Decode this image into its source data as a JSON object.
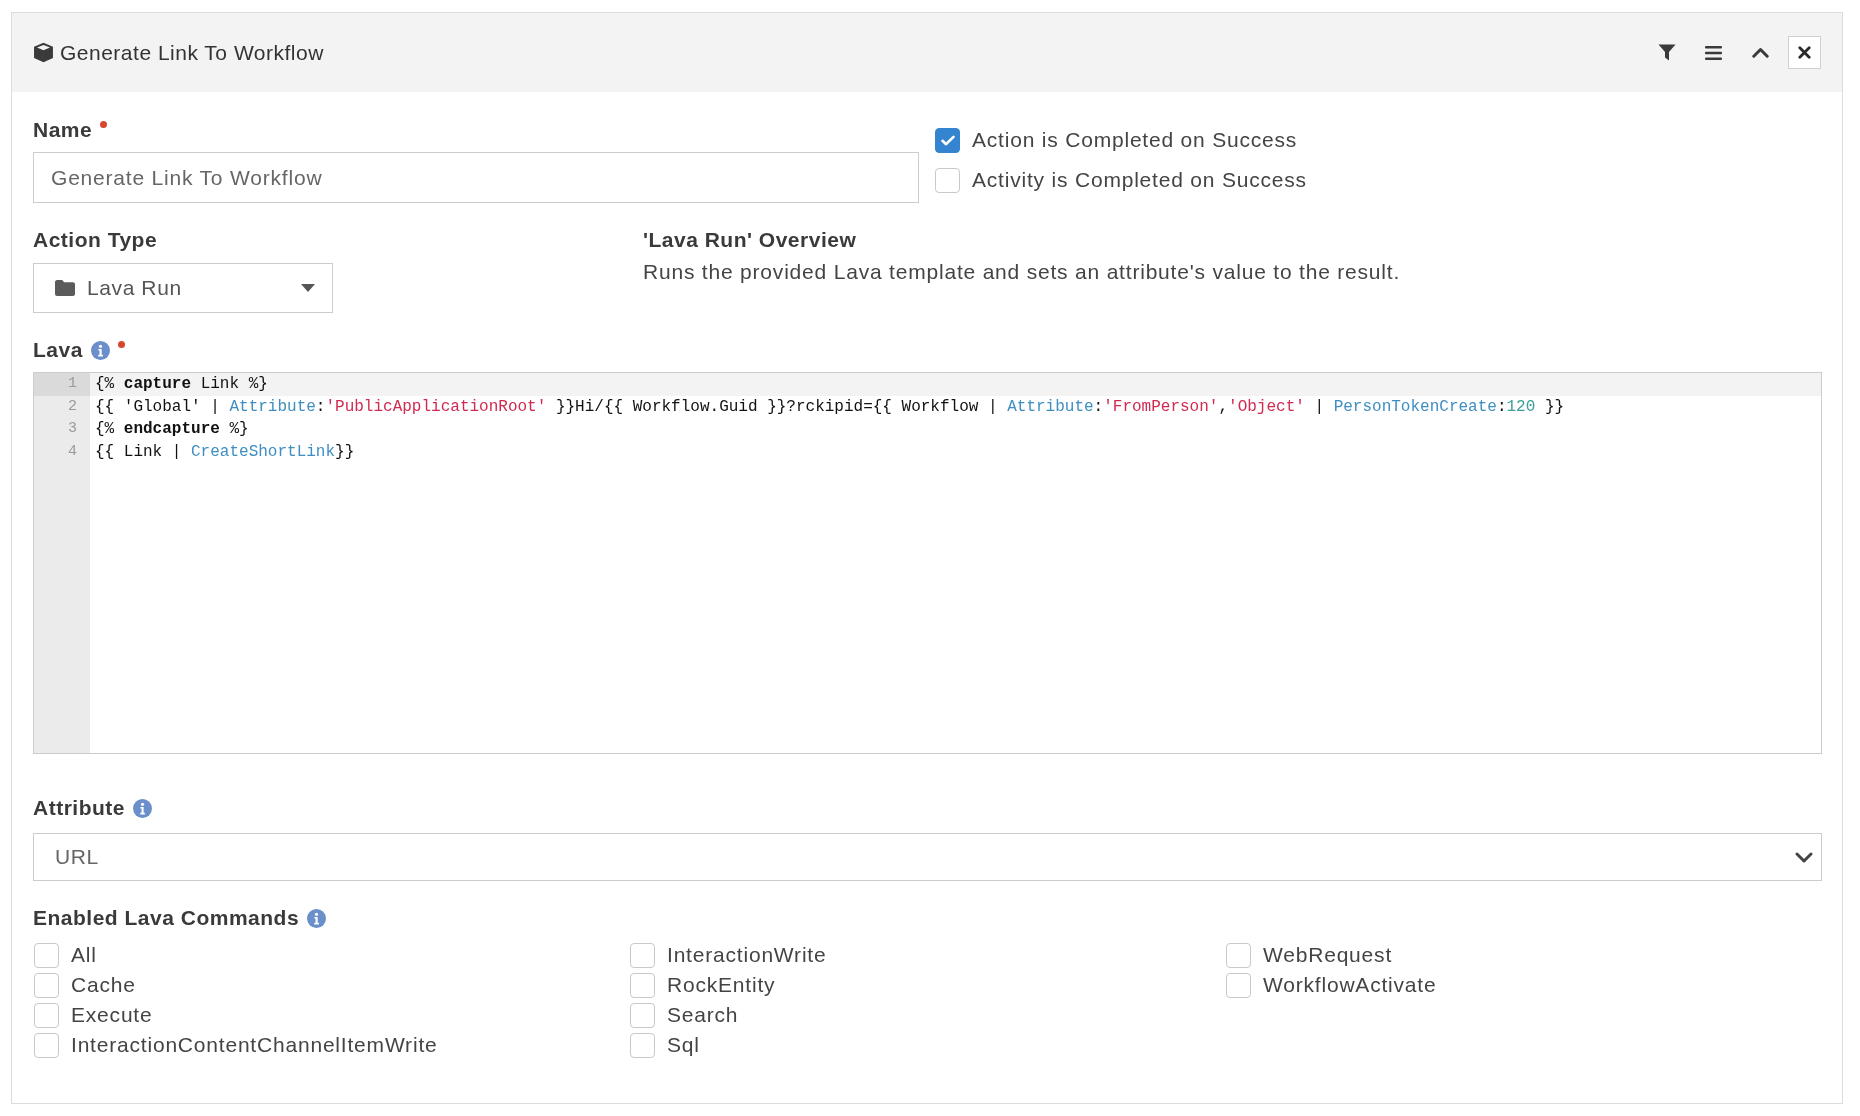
{
  "panel": {
    "title": "Generate Link To Workflow"
  },
  "name": {
    "label": "Name",
    "required": true,
    "value": "Generate Link To Workflow"
  },
  "completion_options": [
    {
      "label": "Action is Completed on Success",
      "checked": true
    },
    {
      "label": "Activity is Completed on Success",
      "checked": false
    }
  ],
  "action_type": {
    "label": "Action Type",
    "value": "Lava Run"
  },
  "overview": {
    "title": "'Lava Run' Overview",
    "text": "Runs the provided Lava template and sets an attribute's value to the result."
  },
  "lava": {
    "label": "Lava",
    "help": true,
    "required": true,
    "lines": [
      {
        "number": "1",
        "active": true,
        "tokens": [
          {
            "kind": "plain",
            "text": "{% "
          },
          {
            "kind": "keyword",
            "text": "capture"
          },
          {
            "kind": "plain",
            "text": " Link %}"
          }
        ]
      },
      {
        "number": "2",
        "active": false,
        "tokens": [
          {
            "kind": "plain",
            "text": "{{ 'Global' | "
          },
          {
            "kind": "filter",
            "text": "Attribute"
          },
          {
            "kind": "plain",
            "text": ":"
          },
          {
            "kind": "string",
            "text": "'PublicApplicationRoot'"
          },
          {
            "kind": "plain",
            "text": " }}Hi/{{ Workflow.Guid }}?rckipid={{ Workflow | "
          },
          {
            "kind": "filter",
            "text": "Attribute"
          },
          {
            "kind": "plain",
            "text": ":"
          },
          {
            "kind": "string",
            "text": "'FromPerson'"
          },
          {
            "kind": "plain",
            "text": ","
          },
          {
            "kind": "string",
            "text": "'Object'"
          },
          {
            "kind": "plain",
            "text": " | "
          },
          {
            "kind": "filter",
            "text": "PersonTokenCreate"
          },
          {
            "kind": "plain",
            "text": ":"
          },
          {
            "kind": "number",
            "text": "120"
          },
          {
            "kind": "plain",
            "text": " }}"
          }
        ]
      },
      {
        "number": "3",
        "active": false,
        "tokens": [
          {
            "kind": "plain",
            "text": "{% "
          },
          {
            "kind": "keyword",
            "text": "endcapture"
          },
          {
            "kind": "plain",
            "text": " %}"
          }
        ]
      },
      {
        "number": "4",
        "active": false,
        "tokens": [
          {
            "kind": "plain",
            "text": "{{ Link | "
          },
          {
            "kind": "filter",
            "text": "CreateShortLink"
          },
          {
            "kind": "plain",
            "text": "}}"
          }
        ]
      }
    ]
  },
  "attribute": {
    "label": "Attribute",
    "help": true,
    "value": "URL"
  },
  "lava_commands": {
    "label": "Enabled Lava Commands",
    "help": true,
    "columns": [
      {
        "items": [
          {
            "label": "All",
            "checked": false
          },
          {
            "label": "Cache",
            "checked": false
          },
          {
            "label": "Execute",
            "checked": false
          },
          {
            "label": "InteractionContentChannelItemWrite",
            "checked": false
          }
        ]
      },
      {
        "items": [
          {
            "label": "InteractionWrite",
            "checked": false
          },
          {
            "label": "RockEntity",
            "checked": false
          },
          {
            "label": "Search",
            "checked": false
          },
          {
            "label": "Sql",
            "checked": false
          }
        ]
      },
      {
        "items": [
          {
            "label": "WebRequest",
            "checked": false
          },
          {
            "label": "WorkflowActivate",
            "checked": false
          }
        ]
      }
    ]
  }
}
